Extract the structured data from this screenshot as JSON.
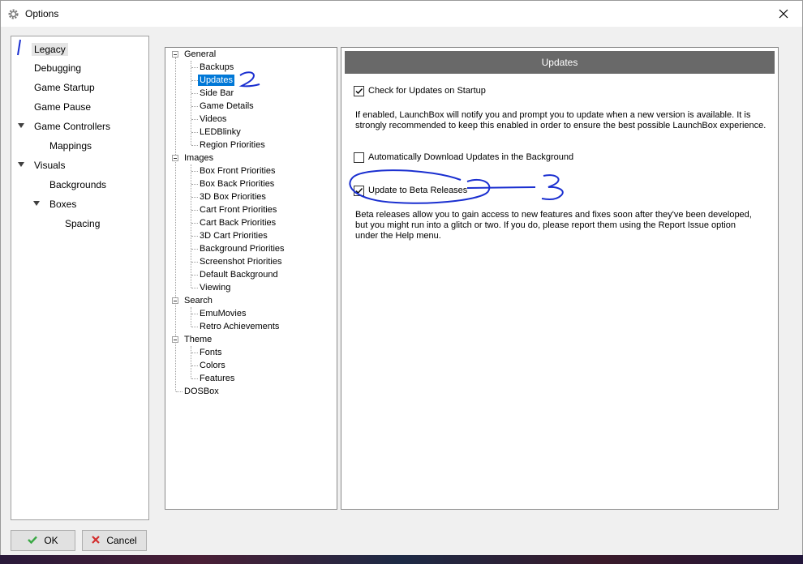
{
  "window": {
    "title": "Options"
  },
  "left_nav": {
    "items": [
      {
        "label": "Legacy",
        "selected": true
      },
      {
        "label": "Debugging"
      },
      {
        "label": "Game Startup"
      },
      {
        "label": "Game Pause"
      },
      {
        "label": "Game Controllers",
        "expanded": true
      },
      {
        "label": "Mappings"
      },
      {
        "label": "Visuals",
        "expanded": true
      },
      {
        "label": "Backgrounds"
      },
      {
        "label": "Boxes",
        "expanded": true
      },
      {
        "label": "Spacing"
      }
    ]
  },
  "tree": {
    "groups": [
      {
        "label": "General",
        "children": [
          "Backups",
          "Updates",
          "Side Bar",
          "Game Details",
          "Videos",
          "LEDBlinky",
          "Region Priorities"
        ]
      },
      {
        "label": "Images",
        "children": [
          "Box Front Priorities",
          "Box Back Priorities",
          "3D Box Priorities",
          "Cart Front Priorities",
          "Cart Back Priorities",
          "3D Cart Priorities",
          "Background Priorities",
          "Screenshot Priorities",
          "Default Background",
          "Viewing"
        ]
      },
      {
        "label": "Search",
        "children": [
          "EmuMovies",
          "Retro Achievements"
        ]
      },
      {
        "label": "Theme",
        "children": [
          "Fonts",
          "Colors",
          "Features"
        ]
      }
    ],
    "leaf": "DOSBox",
    "selected": "Updates"
  },
  "updates": {
    "header": "Updates",
    "check_startup": {
      "label": "Check for Updates on Startup",
      "checked": true
    },
    "check_startup_desc": "If enabled, LaunchBox will notify you and prompt you to update when a new version is available. It is strongly recommended to keep this enabled in order to ensure the best possible LaunchBox experience.",
    "auto_download": {
      "label": "Automatically Download Updates in the Background",
      "checked": false
    },
    "beta": {
      "label": "Update to Beta Releases",
      "checked": true
    },
    "beta_desc": "Beta releases allow you to gain access to new features and fixes soon after they've been developed, but you might run into a glitch or two. If you do, please report them using the Report Issue option under the Help menu."
  },
  "buttons": {
    "ok": "OK",
    "cancel": "Cancel"
  },
  "annotations": [
    "1",
    "2",
    "3"
  ],
  "colors": {
    "selection": "#0078d7",
    "header": "#696969",
    "ink": "#1a2fd0",
    "ok_icon": "#3aa845",
    "cancel_icon": "#d32f2f"
  }
}
